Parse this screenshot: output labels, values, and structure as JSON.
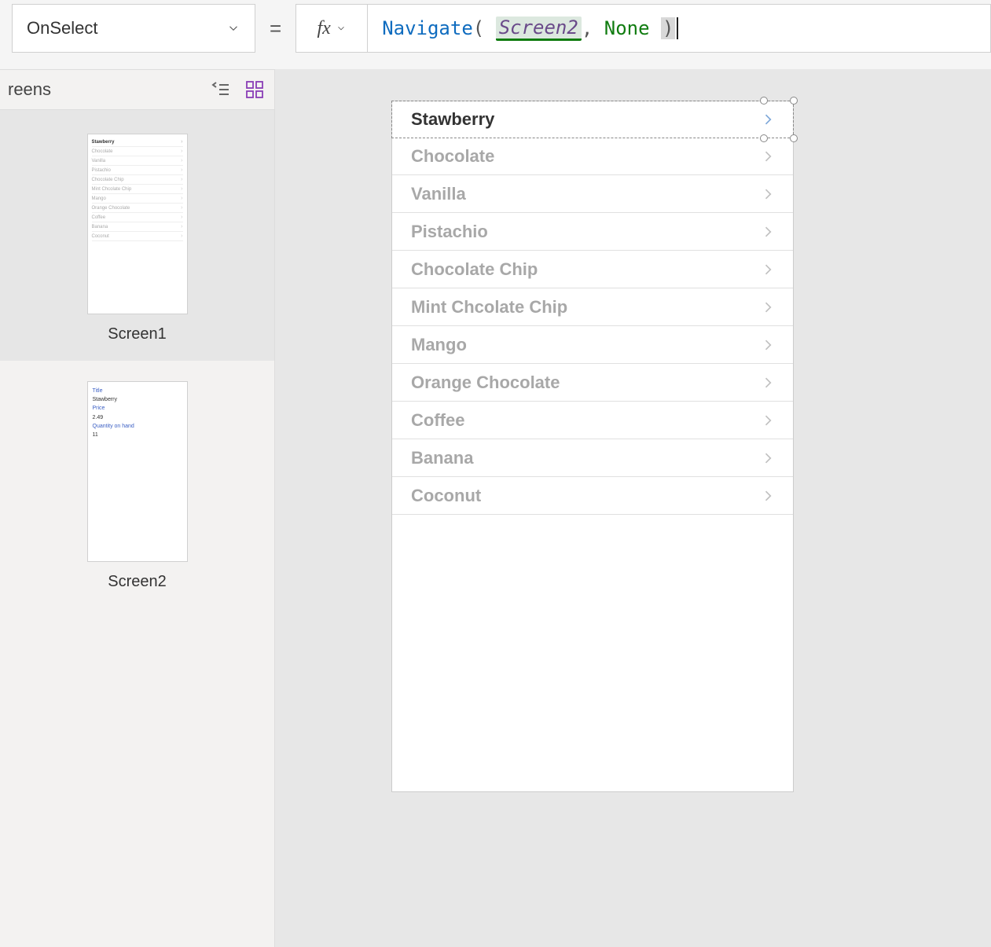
{
  "property": {
    "selected": "OnSelect"
  },
  "formula": {
    "fx_label": "fx",
    "navigate": "Navigate",
    "open_paren": "(",
    "screen_arg": "Screen2",
    "comma": ",",
    "none_arg": "None",
    "close_paren": ")"
  },
  "tree": {
    "title": "reens",
    "screen1": {
      "label": "Screen1"
    },
    "screen2": {
      "label": "Screen2",
      "detail_title_lbl": "Title",
      "detail_title_val": "Stawberry",
      "detail_price_lbl": "Price",
      "detail_price_val": "2.49",
      "detail_qty_lbl": "Quantity on hand",
      "detail_qty_val": "11"
    }
  },
  "thumb_flavors": [
    "Stawberry",
    "Chocolate",
    "Vanilla",
    "Pistachio",
    "Chocolate Chip",
    "Mint Chcolate Chip",
    "Mango",
    "Orange Chocolate",
    "Coffee",
    "Banana",
    "Coconut"
  ],
  "gallery": {
    "items": [
      "Stawberry",
      "Chocolate",
      "Vanilla",
      "Pistachio",
      "Chocolate Chip",
      "Mint Chcolate Chip",
      "Mango",
      "Orange Chocolate",
      "Coffee",
      "Banana",
      "Coconut"
    ]
  }
}
